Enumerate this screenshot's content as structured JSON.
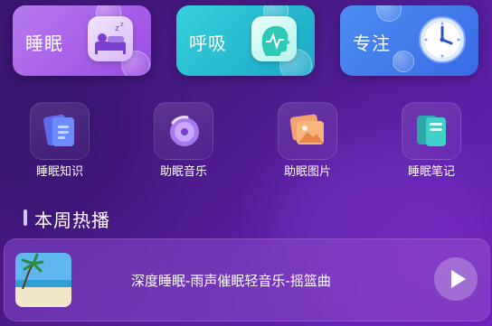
{
  "top_cards": [
    {
      "label": "睡眠",
      "icon": "sleeping-person-icon"
    },
    {
      "label": "呼吸",
      "icon": "breathing-head-icon"
    },
    {
      "label": "专注",
      "icon": "clock-icon"
    }
  ],
  "features": [
    {
      "label": "睡眠知识",
      "icon": "knowledge-cards-icon"
    },
    {
      "label": "助眠音乐",
      "icon": "music-disc-icon"
    },
    {
      "label": "助眠图片",
      "icon": "picture-stack-icon"
    },
    {
      "label": "睡眠笔记",
      "icon": "notebook-icon"
    }
  ],
  "section": {
    "title": "本周热播"
  },
  "now_playing": {
    "title": "深度睡眠-雨声催眠轻音乐-摇篮曲"
  },
  "colors": {
    "background": "#4a1a88",
    "sleep_card": "#a55ee8",
    "breath_card": "#27bcd0",
    "focus_card": "#437bec"
  }
}
